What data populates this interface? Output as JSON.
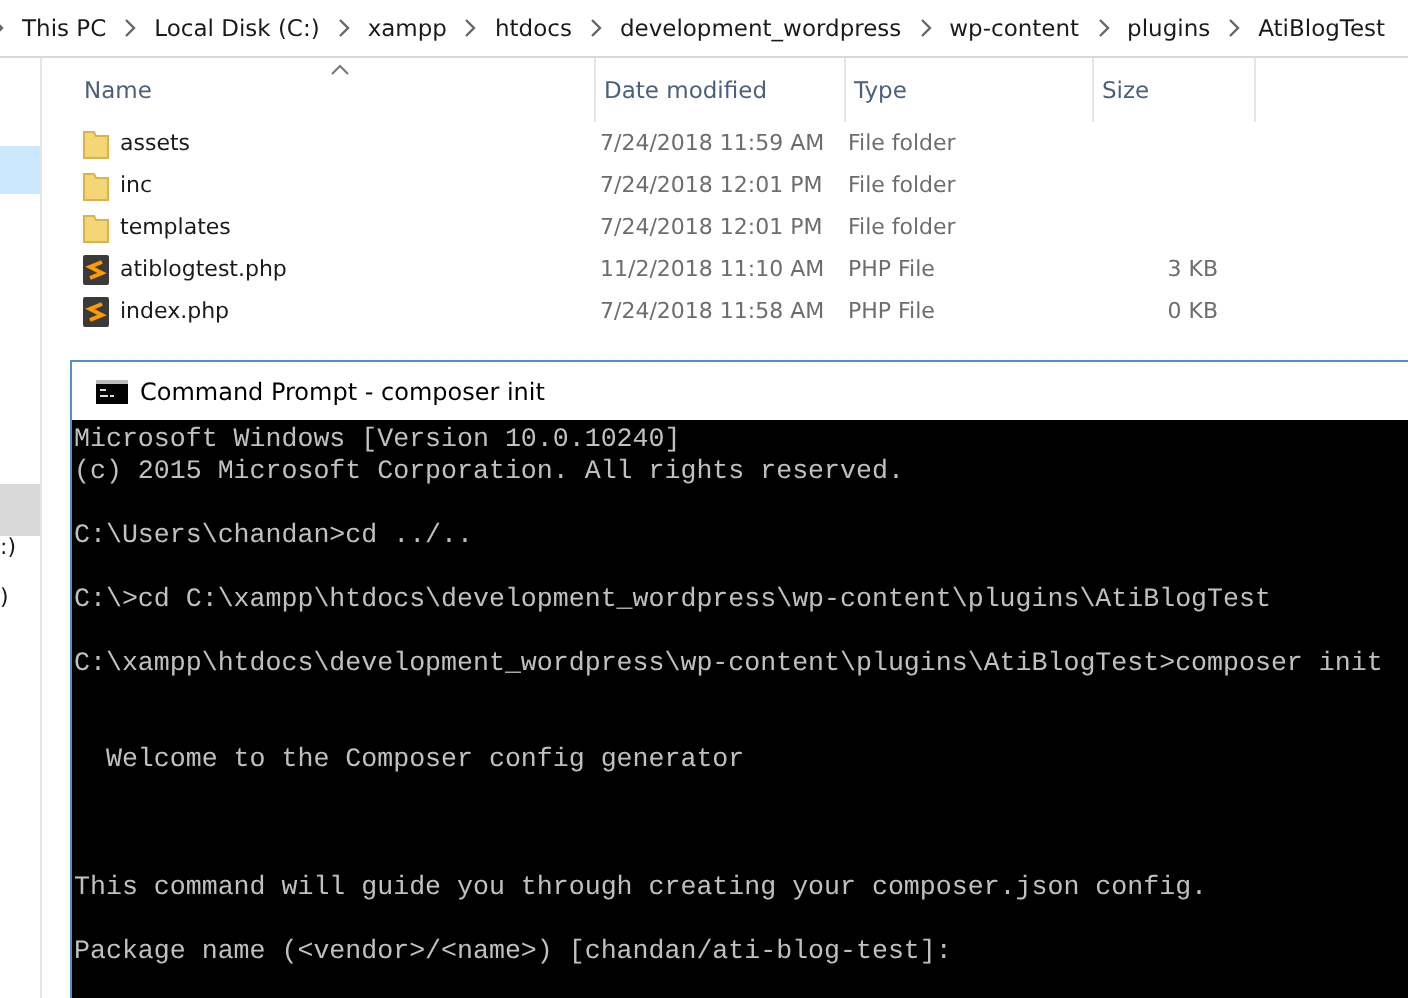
{
  "breadcrumb": [
    "This PC",
    "Local Disk (C:)",
    "xampp",
    "htdocs",
    "development_wordpress",
    "wp-content",
    "plugins",
    "AtiBlogTest"
  ],
  "sidebar": {
    "items": [
      {
        "label": ":)",
        "selected": false
      },
      {
        "label": ")",
        "selected": false
      }
    ]
  },
  "file_list": {
    "columns": [
      "Name",
      "Date modified",
      "Type",
      "Size"
    ],
    "rows": [
      {
        "kind": "folder",
        "name": "assets",
        "date": "7/24/2018 11:59 AM",
        "type": "File folder"
      },
      {
        "kind": "folder",
        "name": "inc",
        "date": "7/24/2018 12:01 PM",
        "type": "File folder"
      },
      {
        "kind": "folder",
        "name": "templates",
        "date": "7/24/2018 12:01 PM",
        "type": "File folder"
      },
      {
        "kind": "php",
        "name": "atiblogtest.php",
        "date": "11/2/2018 11:10 AM",
        "type": "PHP File",
        "size": "3 KB"
      },
      {
        "kind": "php",
        "name": "index.php",
        "date": "7/24/2018 11:58 AM",
        "type": "PHP File",
        "size": "0 KB"
      }
    ]
  },
  "console_window": {
    "title": "Command Prompt - composer  init",
    "output": "Microsoft Windows [Version 10.0.10240]\n(c) 2015 Microsoft Corporation. All rights reserved.\n\nC:\\Users\\chandan>cd ../..\n\nC:\\>cd C:\\xampp\\htdocs\\development_wordpress\\wp-content\\plugins\\AtiBlogTest\n\nC:\\xampp\\htdocs\\development_wordpress\\wp-content\\plugins\\AtiBlogTest>composer init\n\n\n  Welcome to the Composer config generator\n\n\n\nThis command will guide you through creating your composer.json config.\n\nPackage name (<vendor>/<name>) [chandan/ati-blog-test]:"
  }
}
